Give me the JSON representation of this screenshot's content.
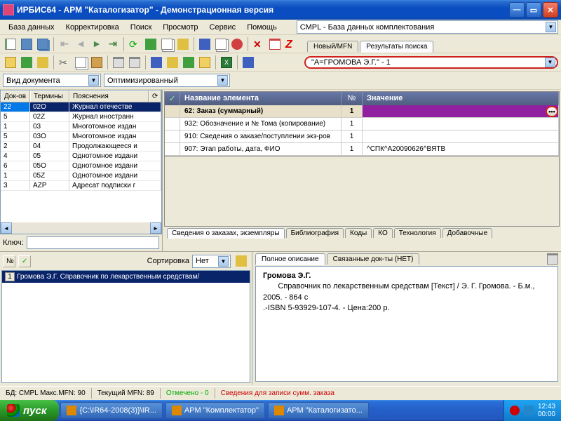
{
  "window": {
    "title": "ИРБИС64 - АРМ \"Каталогизатор\" - Демонстрационная версия"
  },
  "menu": {
    "items": [
      "База данных",
      "Корректировка",
      "Поиск",
      "Просмотр",
      "Сервис",
      "Помощь"
    ],
    "db_selected": "CMPL - База данных комплектования"
  },
  "tabs_top": {
    "new_mfn": "Новый/MFN",
    "results": "Результаты поиска"
  },
  "search_result": "\"A=ГРОМОВА Э.Г.\" - 1",
  "viewbar": {
    "doc_type": "Вид документа",
    "mode": "Оптимизированный"
  },
  "left_grid": {
    "headers": [
      "Док-ов",
      "Термины",
      "Пояснения"
    ],
    "refresh_title": "⟳",
    "rows": [
      {
        "c": "22",
        "t": "02О",
        "p": "Журнал отечестве",
        "sel": true
      },
      {
        "c": "5",
        "t": "02Z",
        "p": "Журнал иностранн"
      },
      {
        "c": "1",
        "t": "03",
        "p": "Многотомное издан"
      },
      {
        "c": "5",
        "t": "03О",
        "p": "Многотомное издан"
      },
      {
        "c": "2",
        "t": "04",
        "p": "Продолжающееся и"
      },
      {
        "c": "4",
        "t": "05",
        "p": "Однотомное издани"
      },
      {
        "c": "6",
        "t": "05О",
        "p": "Однотомное издани"
      },
      {
        "c": "1",
        "t": "05Z",
        "p": "Однотомное издани"
      },
      {
        "c": "3",
        "t": "AZP",
        "p": "Адресат подписки г"
      }
    ],
    "key_label": "Ключ:"
  },
  "elem_grid": {
    "h_name": "Название элемента",
    "h_num": "№",
    "h_val": "Значение",
    "rows": [
      {
        "name": "62: Заказ (суммарный)",
        "num": "1",
        "val": "",
        "hl": true,
        "btn": true
      },
      {
        "name": "932: Обозначение и № Тома (копирование)",
        "num": "1",
        "val": ""
      },
      {
        "name": "910: Сведения о заказе/поступлении экз-ров",
        "num": "1",
        "val": ""
      },
      {
        "name": "907: Этап работы, дата, ФИО",
        "num": "1",
        "val": "^СПК^A20090626^BЯТВ"
      }
    ]
  },
  "bottom_tabs": [
    "Сведения о заказах, экземпляры",
    "Библиография",
    "Коды",
    "КО",
    "Технология",
    "Добавочные"
  ],
  "lower_left": {
    "col_num": "№",
    "sort_label": "Сортировка",
    "sort_value": "Нет",
    "row": "Громова Э.Г. Справочник по лекарственным средствам/"
  },
  "lower_right": {
    "tab1": "Полное описание",
    "tab2": "Связанные док-ты (НЕТ)",
    "author": "Громова Э.Г.",
    "line1": "Справочник по лекарственным средствам [Текст] / Э. Г. Громова. - Б.м., 2005. - 864 с",
    "line2": ".-ISBN 5-93929-107-4. - Цена:200 р."
  },
  "status": {
    "db": "БД: CMPL Макс.MFN: 90",
    "cur": "Текущий MFN: 89",
    "marked": "Отмечено - 0",
    "info": "Сведения для записи сумм. заказа"
  },
  "taskbar": {
    "start": "пуск",
    "items": [
      "{C:\\IR64-2008(3)}\\IR...",
      "АРМ \"Комплектатор\"",
      "АРМ \"Каталогизато..."
    ],
    "time": "12:43",
    "date": "00:00"
  }
}
